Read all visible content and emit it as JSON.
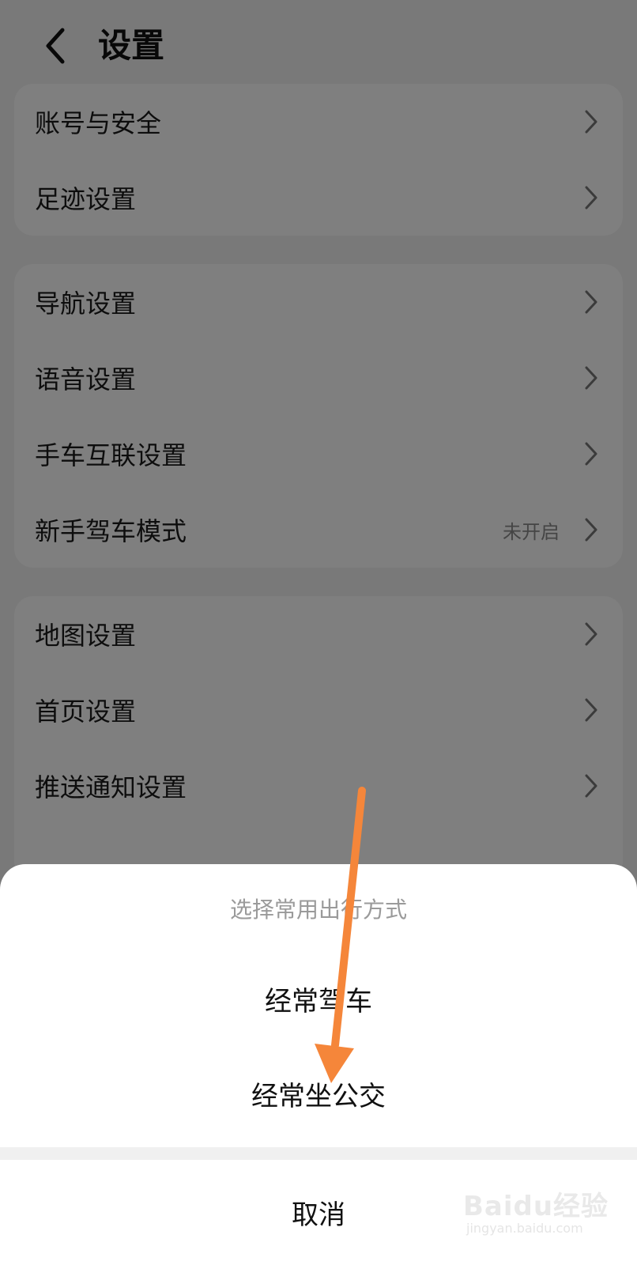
{
  "header": {
    "title": "设置",
    "back_icon": "chevron-left-icon"
  },
  "groups": [
    {
      "items": [
        {
          "label": "账号与安全",
          "value": ""
        },
        {
          "label": "足迹设置",
          "value": ""
        }
      ]
    },
    {
      "items": [
        {
          "label": "导航设置",
          "value": ""
        },
        {
          "label": "语音设置",
          "value": ""
        },
        {
          "label": "手车互联设置",
          "value": ""
        },
        {
          "label": "新手驾车模式",
          "value": "未开启"
        }
      ]
    },
    {
      "items": [
        {
          "label": "地图设置",
          "value": ""
        },
        {
          "label": "首页设置",
          "value": ""
        },
        {
          "label": "推送通知设置",
          "value": ""
        }
      ]
    }
  ],
  "sheet": {
    "title": "选择常用出行方式",
    "options": [
      "经常驾车",
      "经常坐公交"
    ],
    "cancel": "取消"
  },
  "annotation": {
    "color": "#f5863a",
    "icon": "arrow-down-icon"
  },
  "watermark": {
    "main": "Baidu经验",
    "sub": "jingyan.baidu.com"
  },
  "colors": {
    "overlay": "rgba(0,0,0,0.5)",
    "muted_text": "#8a8a8a"
  }
}
